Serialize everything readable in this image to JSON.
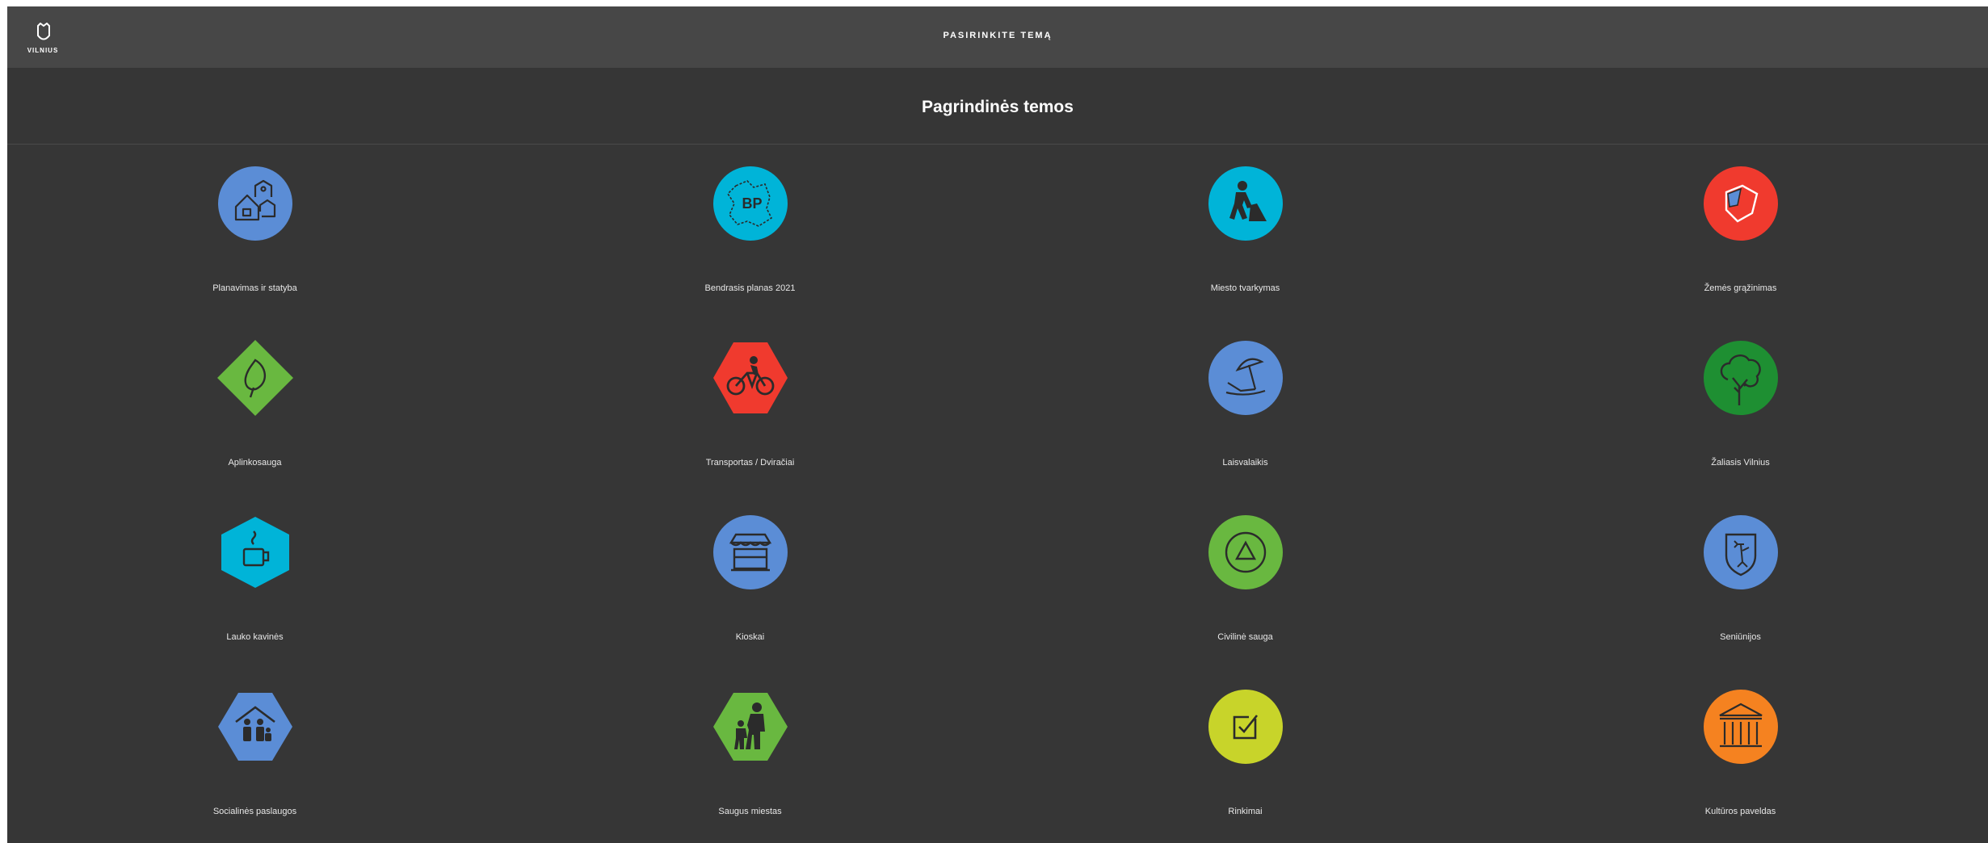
{
  "header": {
    "logo_text": "VILNIUS",
    "title": "PASIRINKITE TEMĄ"
  },
  "section": {
    "title": "Pagrindinės temos"
  },
  "colors": {
    "blue": "#5b8dd6",
    "cyan": "#00b4d8",
    "red": "#f03a2e",
    "green": "#69b840",
    "dark_green": "#1e8f32",
    "lime": "#c8d42a",
    "orange": "#f58220"
  },
  "topics": [
    {
      "label": "Planavimas ir statyba",
      "icon": "buildings-icon"
    },
    {
      "label": "Bendrasis planas 2021",
      "icon": "bp-map-icon"
    },
    {
      "label": "Miesto tvarkymas",
      "icon": "worker-shovel-icon"
    },
    {
      "label": "Žemės grąžinimas",
      "icon": "land-parcel-icon"
    },
    {
      "label": "Aplinkosauga",
      "icon": "leaf-icon"
    },
    {
      "label": "Transportas / Dviračiai",
      "icon": "bicycle-icon"
    },
    {
      "label": "Laisvalaikis",
      "icon": "beach-umbrella-icon"
    },
    {
      "label": "Žaliasis Vilnius",
      "icon": "tree-icon"
    },
    {
      "label": "Lauko kavinės",
      "icon": "coffee-cup-icon"
    },
    {
      "label": "Kioskai",
      "icon": "kiosk-icon"
    },
    {
      "label": "Civilinė sauga",
      "icon": "civil-defense-icon"
    },
    {
      "label": "Seniūnijos",
      "icon": "coat-of-arms-icon"
    },
    {
      "label": "Socialinės paslaugos",
      "icon": "family-icon"
    },
    {
      "label": "Saugus miestas",
      "icon": "parent-child-icon"
    },
    {
      "label": "Rinkimai",
      "icon": "ballot-check-icon"
    },
    {
      "label": "Kultūros paveldas",
      "icon": "heritage-building-icon"
    }
  ]
}
